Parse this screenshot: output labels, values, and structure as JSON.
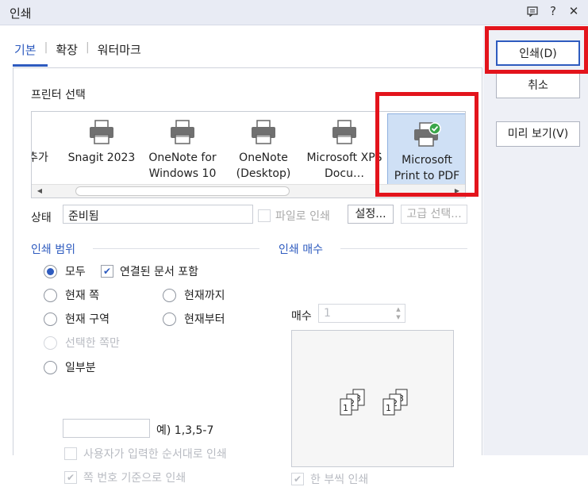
{
  "window": {
    "title": "인쇄"
  },
  "tabs": [
    {
      "label": "기본"
    },
    {
      "label": "확장"
    },
    {
      "label": "워터마크"
    }
  ],
  "printer_section": {
    "title": "프린터 선택",
    "printers": [
      {
        "label": "추가",
        "icon": "add-printer-icon"
      },
      {
        "label": "Snagit 2023",
        "icon": "printer-icon"
      },
      {
        "label": "OneNote for Windows 10",
        "icon": "printer-icon"
      },
      {
        "label": "OneNote (Desktop)",
        "icon": "printer-icon"
      },
      {
        "label": "Microsoft XPS Docu…",
        "icon": "printer-icon"
      },
      {
        "label": "Microsoft Print to PDF",
        "icon": "printer-default-icon",
        "selected": true
      }
    ],
    "status_label": "상태",
    "status_value": "준비됨",
    "file_print_label": "파일로 인쇄",
    "settings_label": "설정...",
    "advanced_label": "고급 선택..."
  },
  "print_range": {
    "title": "인쇄 범위",
    "all": "모두",
    "include_linked": "연결된 문서 포함",
    "current_page": "현재 쪽",
    "to_current": "현재까지",
    "current_section": "현재 구역",
    "from_current": "현재부터",
    "selected_pages": "선택한 쪽만",
    "some_pages": "일부분",
    "example": "예) 1,3,5-7",
    "user_order": "사용자가 입력한 순서대로 인쇄",
    "page_number_based": "쪽 번호 기준으로 인쇄"
  },
  "copies": {
    "title": "인쇄 매수",
    "label": "매수",
    "value": "1",
    "collate": "한 부씩 인쇄"
  },
  "actions": {
    "print": "인쇄(D)",
    "cancel": "취소",
    "preview": "미리 보기(V)"
  },
  "colors": {
    "accent": "#2e5bbf",
    "highlight": "#e3141c",
    "selected_bg": "#cfe0f5"
  }
}
